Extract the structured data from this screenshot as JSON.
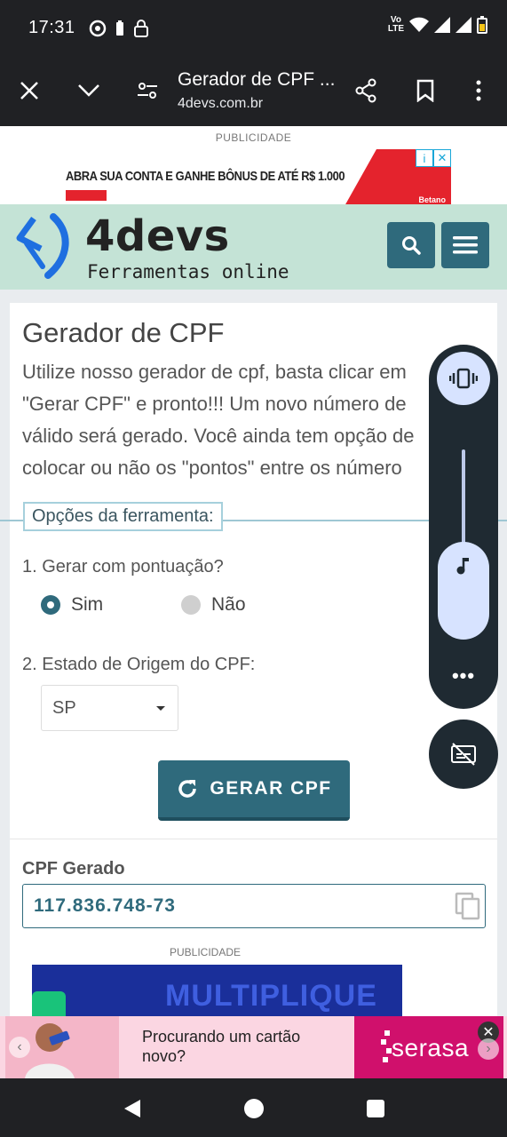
{
  "status_bar": {
    "time": "17:31",
    "network": "Vo\nLTE"
  },
  "browser": {
    "title": "Gerador de CPF ...",
    "url": "4devs.com.br"
  },
  "ads": {
    "top_label": "PUBLICIDADE",
    "top_headline": "ABRA SUA CONTA E GANHE BÔNUS DE ATÉ R$ 1.000",
    "top_brand": "Betano",
    "middle_label": "PUBLICIDADE",
    "middle_text": "MULTIPLIQUE",
    "bottom_text_line1": "Procurando um cartão",
    "bottom_text_line2": "novo?",
    "bottom_brand": "serasa"
  },
  "header": {
    "logo_name": "4devs",
    "logo_sub": "Ferramentas online"
  },
  "main": {
    "title": "Gerador de CPF",
    "description_lines": [
      "Utilize nosso gerador de cpf, basta clicar em",
      "\"Gerar CPF\" e pronto!!! Um novo número de",
      "válido será gerado. Você ainda tem opção de",
      "colocar ou não os \"pontos\" entre os número"
    ],
    "options_legend": "Opções da ferramenta:",
    "q1_label": "1. Gerar com pontuação?",
    "q1_options": [
      "Sim",
      "Não"
    ],
    "q1_selected": "Sim",
    "q2_label": "2. Estado de Origem do CPF:",
    "state_selected": "SP",
    "generate_label": "GERAR CPF",
    "result_label": "CPF Gerado",
    "result_value": "117.836.748-73"
  },
  "colors": {
    "primary": "#2f6a7c",
    "header_bg": "#c4e3d6",
    "overlay": "#1f2a32"
  },
  "icons": [
    "close-icon",
    "chevron-down-icon",
    "tune-icon",
    "share-icon",
    "bookmark-icon",
    "more-vert-icon",
    "search-icon",
    "menu-icon",
    "refresh-icon",
    "copy-icon",
    "vibrate-icon",
    "music-note-icon",
    "captions-off-icon",
    "back-icon",
    "home-icon",
    "recents-icon"
  ]
}
